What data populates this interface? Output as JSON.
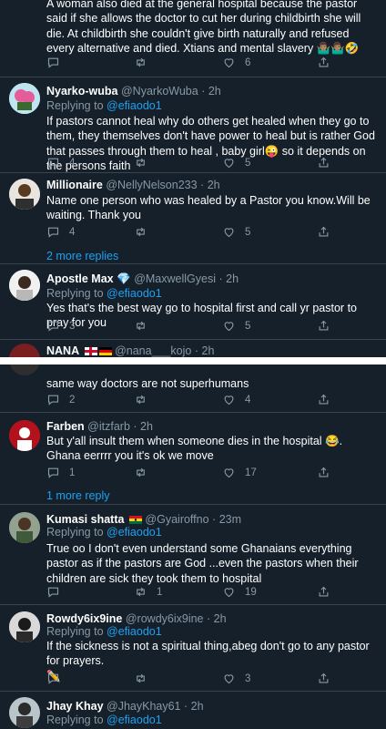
{
  "top_tweet": {
    "text": "A woman also died at the general hospital because the pastor said if she allows the doctor to cut her during childbirth she will die. At childbirth she couldn't give birth naturally and refused every alternative and died. Xtians and mental slavery",
    "text_emojis": "🤷🏽‍♂️🤷🏽‍♂️🤣",
    "replies": "",
    "retweets": "",
    "likes": "6"
  },
  "tweets": [
    {
      "name": "Nyarko-wuba",
      "handle": "@NyarkoWuba",
      "time": "2h",
      "replying_label": "Replying to",
      "replying_to": "@efiaodo1",
      "text": "If pastors cannot heal why do others get healed when they go to them, they themselves don't have power to heal but is rather God that passes through them to heal , baby girl",
      "text_emoji": "😜",
      "text_tail": " so it depends on the persons faith",
      "replies": "4",
      "retweets": "",
      "likes": "5"
    },
    {
      "name": "Millionaire",
      "handle": "@NellyNelson233",
      "time": "2h",
      "text": "Name one person who was healed by a Pastor you know.Will be waiting. Thank you",
      "replies": "4",
      "retweets": "",
      "likes": "5",
      "more_replies": "2 more replies"
    },
    {
      "name": "Apostle Max",
      "name_badge": "💎",
      "handle": "@MaxwellGyesi",
      "time": "2h",
      "replying_label": "Replying to",
      "replying_to": "@efiaodo1",
      "text": "Yes that's the best way go to hospital first and call yr pastor to pray for you",
      "replies": "3",
      "retweets": "",
      "likes": "5"
    },
    {
      "name": "NANA",
      "handle": "@nana___kojo",
      "time": "2h"
    }
  ],
  "tweets_b": [
    {
      "text": "same way doctors are not superhumans",
      "replies": "2",
      "retweets": "",
      "likes": "4"
    },
    {
      "name": "Farben",
      "handle": "@itzfarb",
      "time": "2h",
      "text": "But y'all insult them when someone dies in the hospital",
      "text_emoji": "😂",
      "text_tail": ". Ghana eerrrr you it's ok we move",
      "replies": "1",
      "retweets": "",
      "likes": "17",
      "more_replies": "1 more reply"
    },
    {
      "name": "Kumasi shatta",
      "handle": "@Gyairoffno",
      "time": "23m",
      "replying_label": "Replying to",
      "replying_to": "@efiaodo1",
      "text": "True oo I don't even understand some Ghanaians everything pastor as if the pastors are God ...even the pastors when their children are sick they took them to hospital",
      "replies": "",
      "retweets": "1",
      "likes": "19"
    },
    {
      "name": "Rowdy6ix9ine",
      "handle": "@rowdy6ix9ine",
      "time": "2h",
      "replying_label": "Replying to",
      "replying_to": "@efiaodo1",
      "text": "If the sickness is not a spiritual thing,abeg don't go to any pastor for prayers.",
      "text_emoji": "✏️",
      "replies": "",
      "retweets": "",
      "likes": "3"
    },
    {
      "name": "Jhay Khay",
      "handle": "@JhayKhay61",
      "time": "2h",
      "replying_label": "Replying to",
      "replying_to": "@efiaodo1"
    }
  ],
  "icons": {
    "reply": "comment-icon",
    "retweet": "retweet-icon",
    "like": "heart-icon",
    "share": "share-icon"
  },
  "colors": {
    "background": "#15202b",
    "text": "#ffffff",
    "secondary": "#8899a6",
    "link": "#1da1f2",
    "separator": "#38444d"
  }
}
